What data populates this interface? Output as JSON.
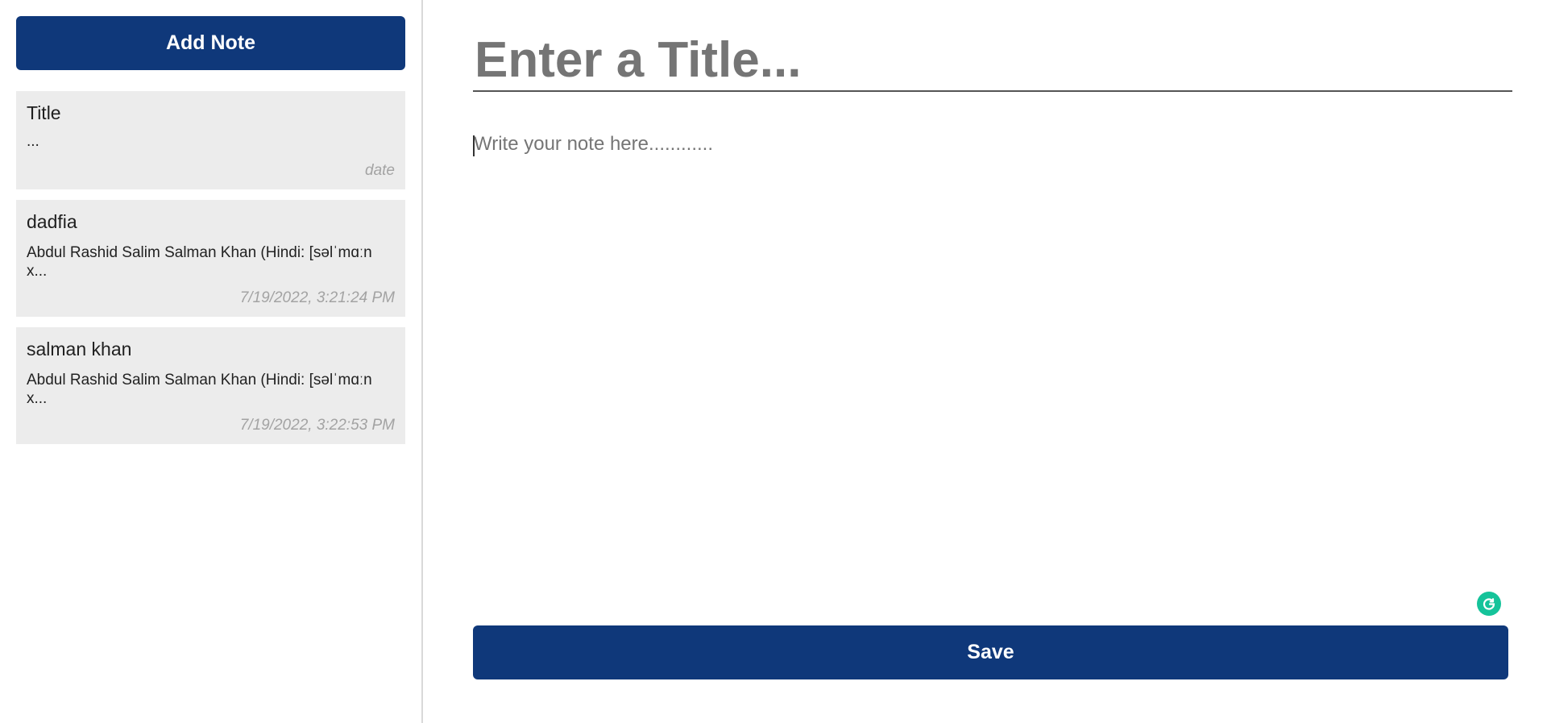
{
  "sidebar": {
    "add_note_label": "Add Note",
    "notes": [
      {
        "title": "Title",
        "body": "...",
        "date": "date"
      },
      {
        "title": "dadfia",
        "body": "Abdul Rashid Salim Salman Khan (Hindi: [səlˈmɑːn x...",
        "date": "7/19/2022, 3:21:24 PM"
      },
      {
        "title": "salman khan",
        "body": "Abdul Rashid Salim Salman Khan (Hindi: [səlˈmɑːn x...",
        "date": "7/19/2022, 3:22:53 PM"
      }
    ]
  },
  "editor": {
    "title_placeholder": "Enter a Title...",
    "title_value": "",
    "body_placeholder": "Write your note here............",
    "body_value": "",
    "save_label": "Save",
    "grammarly_icon": "grammarly-icon"
  },
  "colors": {
    "primary": "#0f387a",
    "card_bg": "#ececec",
    "date_text": "#a3a3a3",
    "grammarly": "#15c39a"
  }
}
